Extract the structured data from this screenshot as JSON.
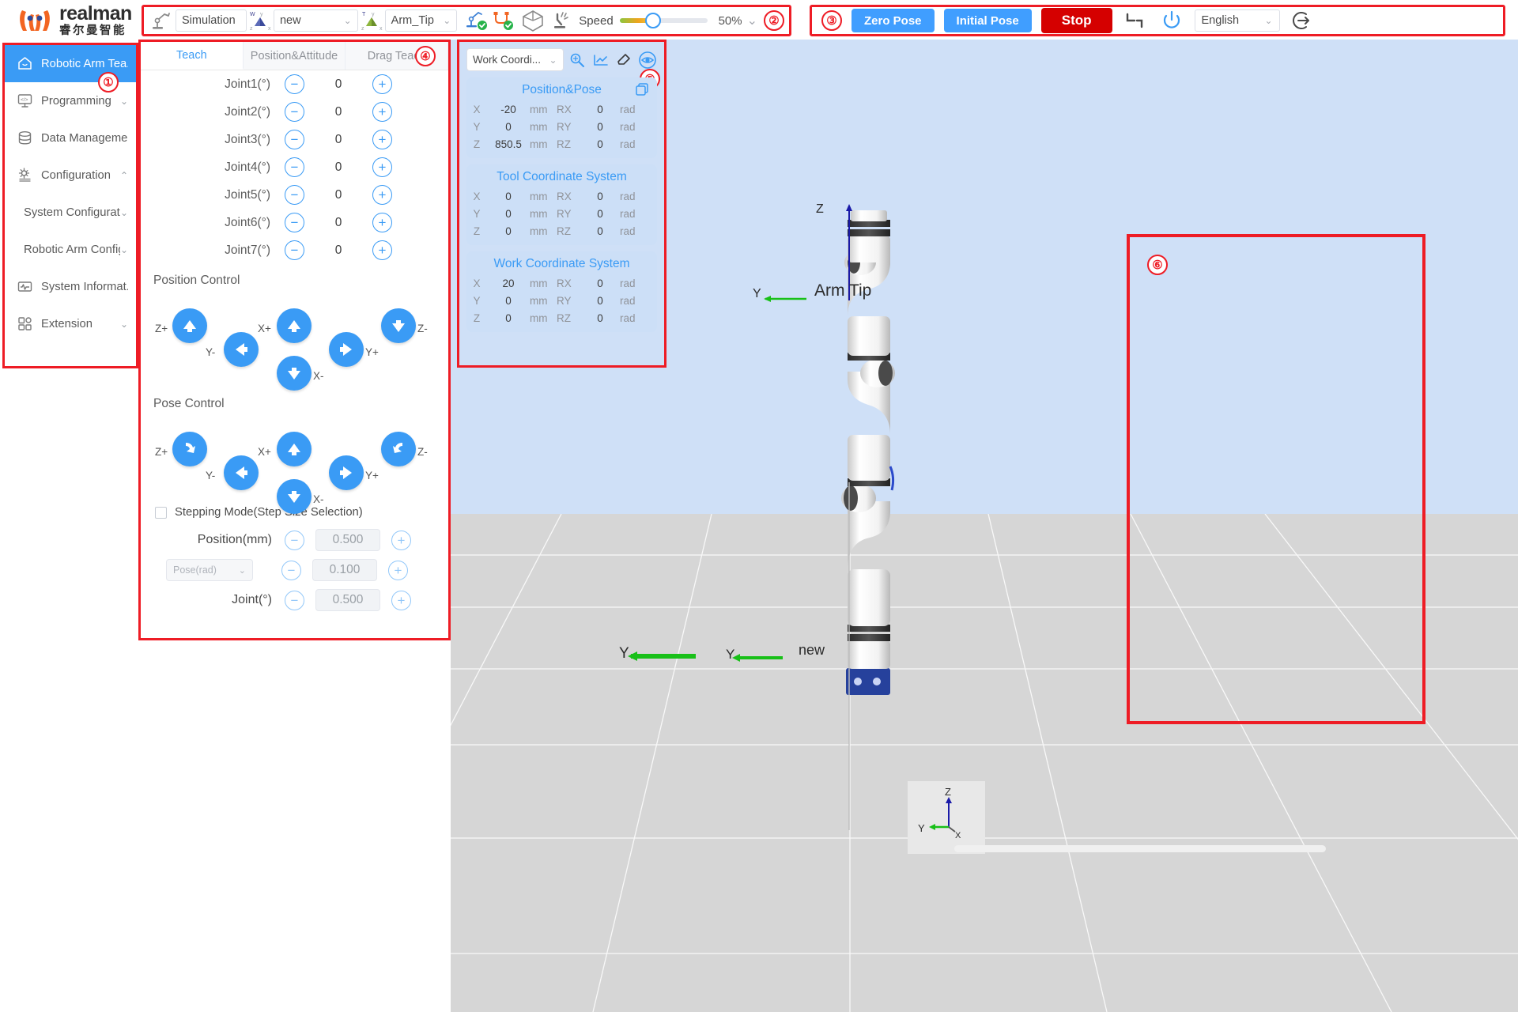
{
  "brand": {
    "name_en": "realman",
    "name_cn": "睿尔曼智能"
  },
  "toolbar": {
    "mode_value": "Simulation",
    "robot_select_value": "new",
    "frame_select_value": "Arm_Tip",
    "speed_label": "Speed",
    "speed_value": "50%",
    "speed_percent": 38,
    "badge": "②",
    "icons": {
      "robot_arm": "robot-arm-icon",
      "world_frame": "world-frame-icon",
      "tool_frame": "tool-frame-icon",
      "arm_status": "arm-status-icon",
      "cable_status": "cable-status-icon",
      "cube": "cube-icon",
      "collision": "collision-icon"
    }
  },
  "actions": {
    "badge": "③",
    "zero_pose": "Zero Pose",
    "initial_pose": "Initial Pose",
    "stop": "Stop",
    "language": "English",
    "icons": {
      "joint": "joint-limit-icon",
      "power": "power-icon",
      "logout": "logout-icon"
    }
  },
  "sidebar": {
    "badge": "①",
    "items": [
      {
        "label": "Robotic Arm Tea...",
        "icon": "home-icon",
        "active": true,
        "chevron": ""
      },
      {
        "label": "Programming",
        "icon": "code-icon",
        "active": false,
        "chevron": "⌄"
      },
      {
        "label": "Data Management",
        "icon": "database-icon",
        "active": false,
        "chevron": ""
      },
      {
        "label": "Configuration",
        "icon": "gear-icon",
        "active": false,
        "chevron": "⌃"
      }
    ],
    "sub_items": [
      {
        "label": "System Configuration",
        "chevron": "⌄"
      },
      {
        "label": "Robotic Arm Config.",
        "chevron": "⌄"
      }
    ],
    "items_after": [
      {
        "label": "System Informat...",
        "icon": "monitor-icon",
        "chevron": ""
      },
      {
        "label": "Extension",
        "icon": "grid-icon",
        "chevron": "⌄"
      }
    ]
  },
  "teach": {
    "badge": "④",
    "tabs": [
      {
        "label": "Teach",
        "active": true
      },
      {
        "label": "Position&Attitude",
        "active": false
      },
      {
        "label": "Drag Teach",
        "active": false
      }
    ],
    "joints": [
      {
        "label": "Joint1(°)",
        "value": "0"
      },
      {
        "label": "Joint2(°)",
        "value": "0"
      },
      {
        "label": "Joint3(°)",
        "value": "0"
      },
      {
        "label": "Joint4(°)",
        "value": "0"
      },
      {
        "label": "Joint5(°)",
        "value": "0"
      },
      {
        "label": "Joint6(°)",
        "value": "0"
      },
      {
        "label": "Joint7(°)",
        "value": "0"
      }
    ],
    "position_control_title": "Position Control",
    "pose_control_title": "Pose Control",
    "axis_labels": {
      "zp": "Z+",
      "ym": "Y-",
      "xp": "X+",
      "yp": "Y+",
      "xm": "X-",
      "zm": "Z-"
    },
    "stepping_mode_label": "Stepping Mode(Step Size Selection)",
    "steps": [
      {
        "label": "Position(mm)",
        "value": "0.500",
        "is_select": false
      },
      {
        "label": "Pose(rad)",
        "value": "0.100",
        "is_select": true
      },
      {
        "label": "Joint(°)",
        "value": "0.500",
        "is_select": false
      }
    ]
  },
  "coord": {
    "badge": "⑤",
    "selector_value": "Work Coordi...",
    "icons": {
      "teach_point": "teach-point-icon",
      "set_coord": "set-coordinate-icon",
      "eraser": "eraser-icon",
      "eye": "eye-visibility-icon",
      "copy": "copy-icon"
    },
    "cards": [
      {
        "title": "Position&Pose",
        "rows": [
          {
            "axis": "X",
            "value": "-20",
            "unit": "mm",
            "raxis": "RX",
            "rvalue": "0",
            "runit": "rad"
          },
          {
            "axis": "Y",
            "value": "0",
            "unit": "mm",
            "raxis": "RY",
            "rvalue": "0",
            "runit": "rad"
          },
          {
            "axis": "Z",
            "value": "850.5",
            "unit": "mm",
            "raxis": "RZ",
            "rvalue": "0",
            "runit": "rad"
          }
        ]
      },
      {
        "title": "Tool Coordinate System",
        "rows": [
          {
            "axis": "X",
            "value": "0",
            "unit": "mm",
            "raxis": "RX",
            "rvalue": "0",
            "runit": "rad"
          },
          {
            "axis": "Y",
            "value": "0",
            "unit": "mm",
            "raxis": "RY",
            "rvalue": "0",
            "runit": "rad"
          },
          {
            "axis": "Z",
            "value": "0",
            "unit": "mm",
            "raxis": "RZ",
            "rvalue": "0",
            "runit": "rad"
          }
        ]
      },
      {
        "title": "Work Coordinate System",
        "rows": [
          {
            "axis": "X",
            "value": "20",
            "unit": "mm",
            "raxis": "RX",
            "rvalue": "0",
            "runit": "rad"
          },
          {
            "axis": "Y",
            "value": "0",
            "unit": "mm",
            "raxis": "RY",
            "rvalue": "0",
            "runit": "rad"
          },
          {
            "axis": "Z",
            "value": "0",
            "unit": "mm",
            "raxis": "RZ",
            "rvalue": "0",
            "runit": "rad"
          }
        ]
      }
    ]
  },
  "viewport": {
    "badge": "⑥",
    "arm_tip_label": "Arm Tip",
    "base_label": "new",
    "axis_z": "Z",
    "axis_y": "Y",
    "axis_y2": "Y",
    "widget": {
      "z": "Z",
      "y": "Y",
      "x": "X"
    }
  },
  "colors": {
    "accent_blue": "#3a9bf5",
    "annotation_red": "#ee1c25",
    "stop_red": "#d50000",
    "brand_orange": "#f26522",
    "panel_blue": "#cfe0f7"
  }
}
